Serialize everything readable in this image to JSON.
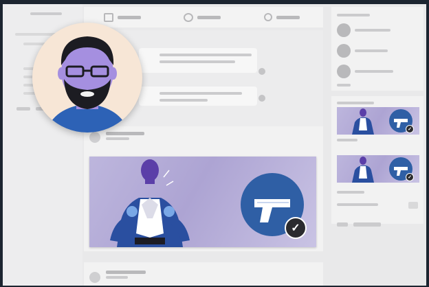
{
  "screen": {
    "description_visible_text": ""
  },
  "colors": {
    "background": "#1c2530",
    "ui_gray": "#e9e9ea",
    "banner_purple": "#ada4d3",
    "badge_blue": "#2f5fa5",
    "hero_blue": "#2a4fa0",
    "hero_head": "#5b3fa8",
    "avatar_bg": "#f7e6d6",
    "avatar_skin": "#a58fe0"
  },
  "icons": {
    "gun": "gun-icon",
    "check": "check-icon",
    "hero": "hero-illustration",
    "avatar": "bearded-man-avatar"
  },
  "badge": {
    "check_glyph": "✓"
  }
}
